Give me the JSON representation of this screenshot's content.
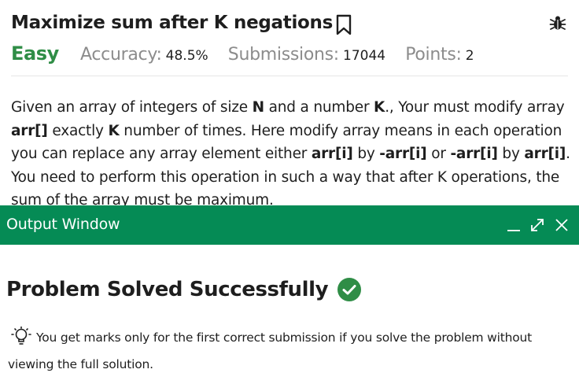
{
  "problem": {
    "title": "Maximize sum after K negations",
    "difficulty": "Easy",
    "accuracy_label": "Accuracy:",
    "accuracy_value": "48.5%",
    "submissions_label": "Submissions:",
    "submissions_value": "17044",
    "points_label": "Points:",
    "points_value": "2",
    "statement": {
      "s1": "Given an array of integers of size ",
      "b1": "N",
      "s2": " and a number ",
      "b2": "K",
      "s3": "., Your must modify array ",
      "b3": "arr[]",
      "s4": " exactly ",
      "b4": "K",
      "s5": " number of times. Here modify array means in each operation you can replace any array element either ",
      "b5": "arr[i]",
      "s6": " by ",
      "b6": "-arr[i]",
      "s7": " or ",
      "b7": "-arr[i]",
      "s8": " by ",
      "b8": "arr[i]",
      "s9": ". You need to perform this operation in such a way that after K operations, the sum of the array must be maximum."
    }
  },
  "output_window": {
    "title": "Output Window",
    "result": "Problem Solved Successfully",
    "tip": "You get marks only for the first correct submission if you solve the problem without viewing the full solution."
  },
  "icons": {
    "bookmark": "bookmark-icon",
    "bug": "bug-icon",
    "minimize": "minimize-icon",
    "expand": "expand-icon",
    "close": "close-icon",
    "check": "check-circle-icon",
    "bulb": "lightbulb-icon"
  },
  "colors": {
    "brand_green": "#058b55",
    "easy_green": "#2f8d46",
    "muted_gray": "#8c8c8c"
  }
}
